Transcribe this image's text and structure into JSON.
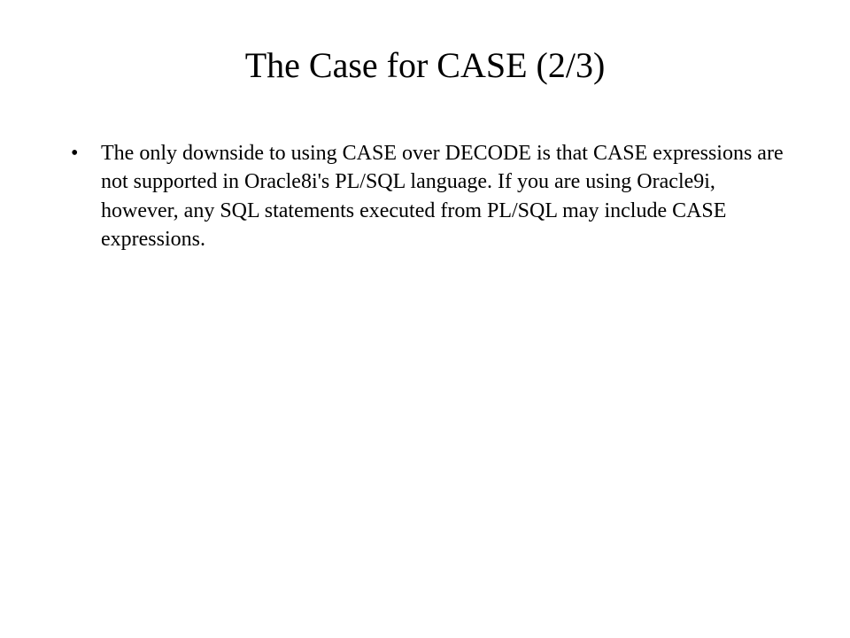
{
  "slide": {
    "title": "The Case for CASE (2/3)",
    "bullets": [
      "The only downside to using CASE over DECODE is that CASE expressions are not supported in Oracle8i's PL/SQL language. If you are using Oracle9i, however, any SQL statements executed from PL/SQL may include CASE expressions."
    ]
  }
}
